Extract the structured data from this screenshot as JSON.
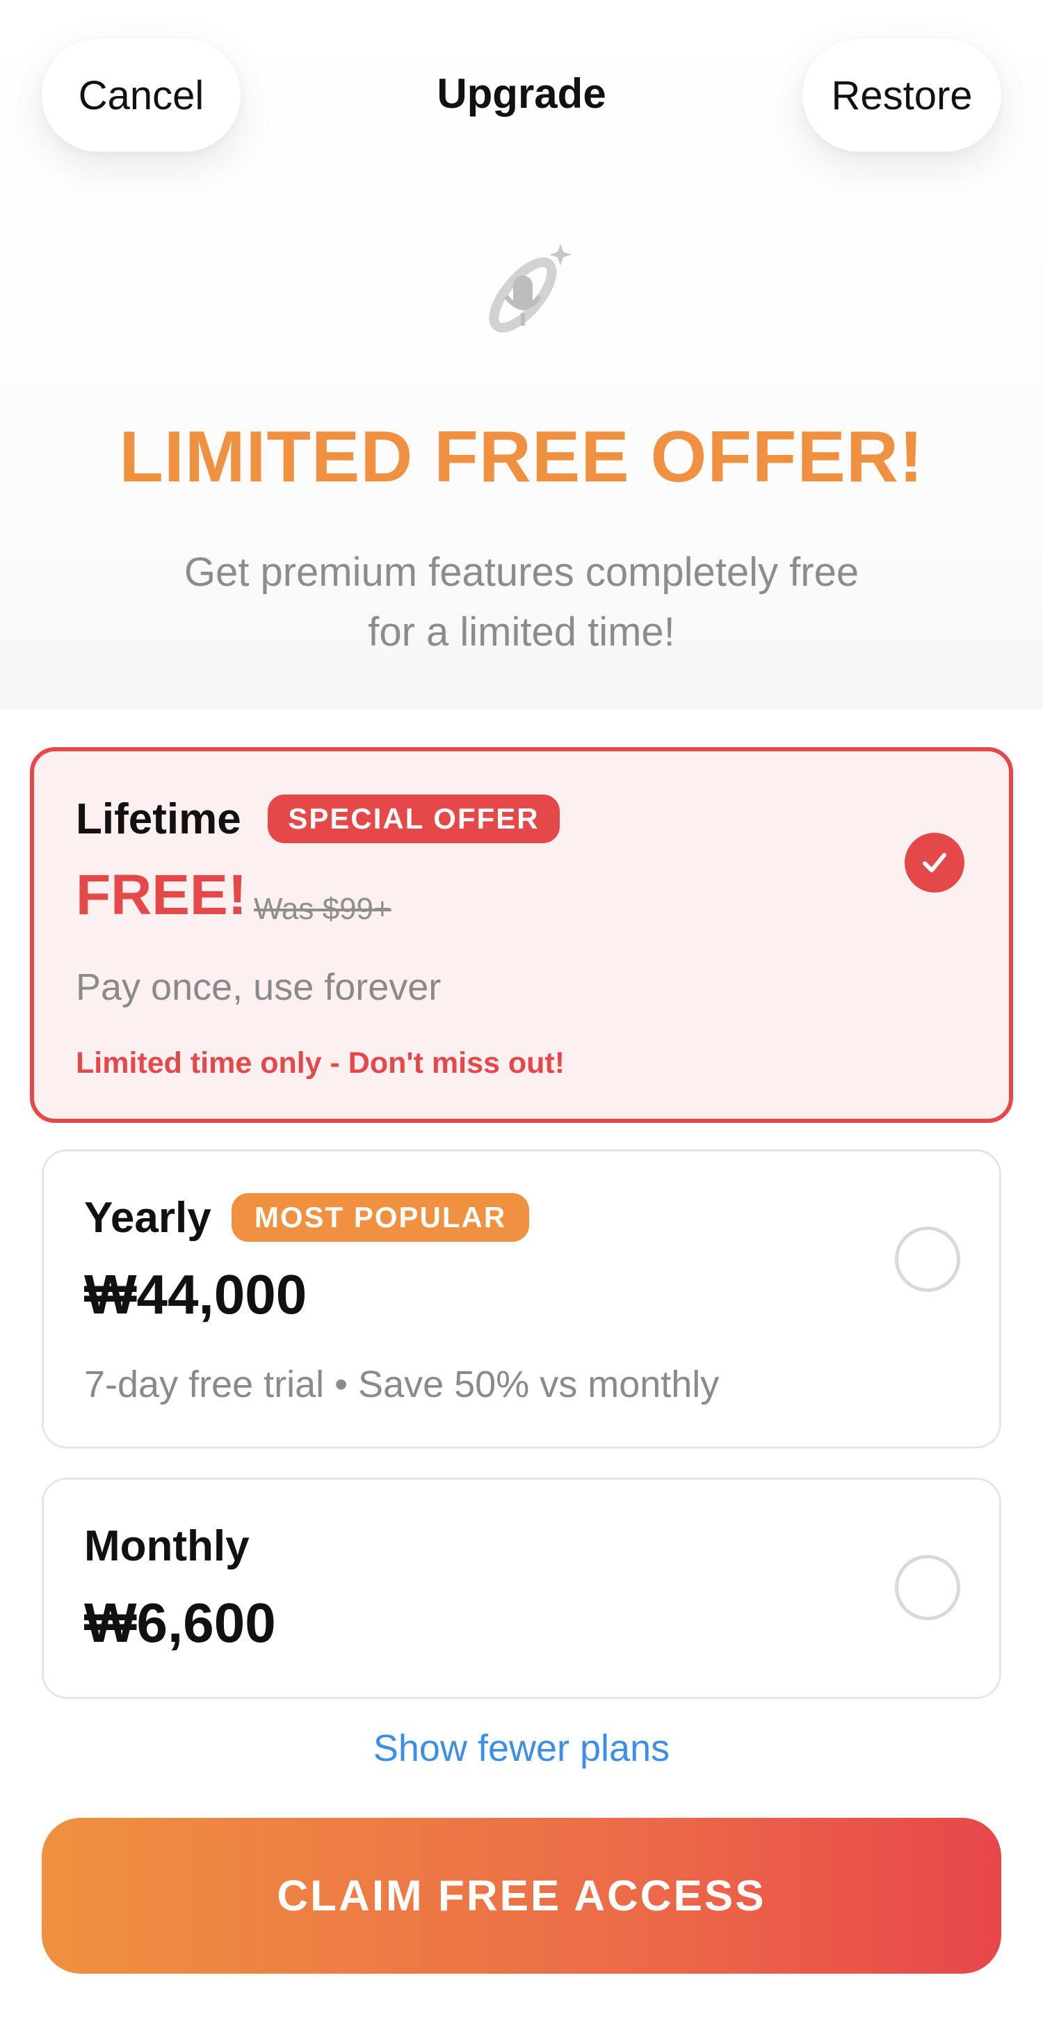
{
  "header": {
    "cancel_label": "Cancel",
    "title": "Upgrade",
    "restore_label": "Restore"
  },
  "hero": {
    "icon": "microphone-sparkle-icon",
    "headline": "LIMITED FREE OFFER!",
    "subline_1": "Get premium features completely free",
    "subline_2": "for a limited time!"
  },
  "plans": [
    {
      "name": "Lifetime",
      "badge": "SPECIAL OFFER",
      "price": "FREE!",
      "was_price": "Was $99+",
      "description": "Pay once, use forever",
      "urgency": "Limited time only - Don't miss out!",
      "selected": true
    },
    {
      "name": "Yearly",
      "badge": "MOST POPULAR",
      "price": "₩44,000",
      "description": "7-day free trial • Save 50% vs monthly",
      "selected": false
    },
    {
      "name": "Monthly",
      "price": "₩6,600",
      "selected": false
    }
  ],
  "footer": {
    "show_fewer_label": "Show fewer plans",
    "cta_label": "CLAIM FREE ACCESS"
  },
  "colors": {
    "accent_orange": "#ef9140",
    "accent_red": "#e54848",
    "link_blue": "#3d8ee6",
    "selected_card_bg": "#fdf0f0"
  }
}
